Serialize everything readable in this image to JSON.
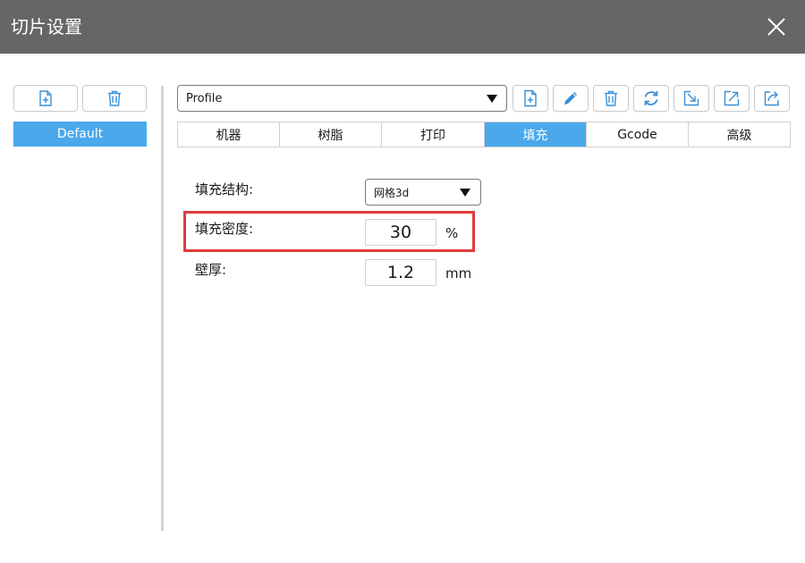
{
  "window": {
    "title": "切片设置",
    "close_icon": "close-icon"
  },
  "sidebar": {
    "add_icon": "add-file-icon",
    "delete_icon": "trash-icon",
    "profiles": [
      "Default"
    ],
    "selected_profile": "Default"
  },
  "toolbar": {
    "profile_value": "Profile",
    "icons": [
      "add-file-icon",
      "edit-pencil-icon",
      "trash-icon",
      "refresh-icon",
      "import-icon",
      "export-icon",
      "share-icon"
    ]
  },
  "tabs": {
    "items": [
      "机器",
      "树脂",
      "打印",
      "填充",
      "Gcode",
      "高级"
    ],
    "active": "填充"
  },
  "fill": {
    "structure_label": "填充结构:",
    "structure_value": "网格3d",
    "density_label": "填充密度:",
    "density_value": "30",
    "density_unit": "%",
    "wall_label": "壁厚:",
    "wall_value": "1.2",
    "wall_unit": "mm"
  },
  "colors": {
    "titlebar": "#666666",
    "accent": "#4aa8eb",
    "highlight": "#e03b3b",
    "icon": "#3a8fd6"
  }
}
